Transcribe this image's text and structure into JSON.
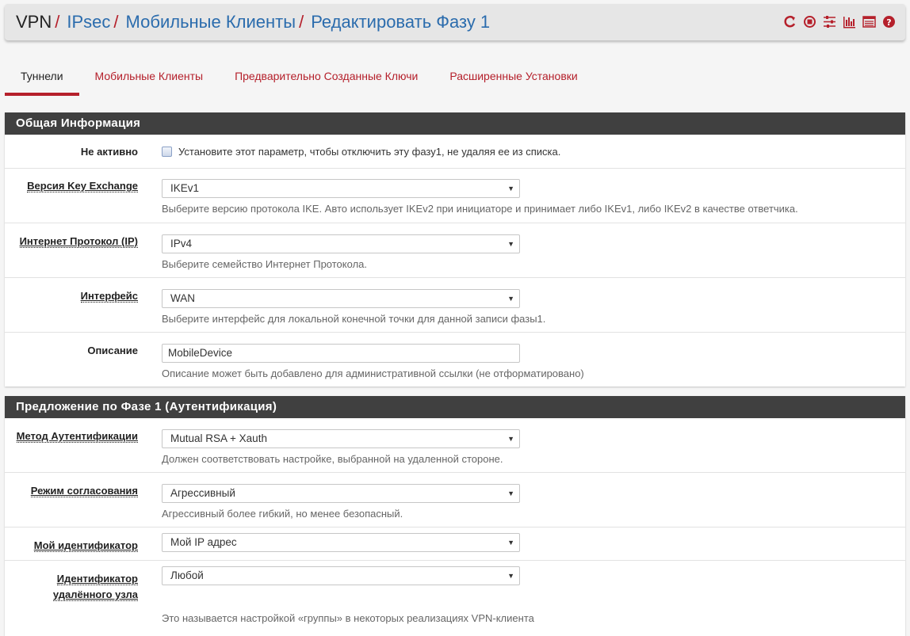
{
  "breadcrumb": [
    "VPN",
    "IPsec",
    "Мобильные Клиенты",
    "Редактировать Фазу 1"
  ],
  "header_icons": [
    "refresh-icon",
    "stop-icon",
    "sliders-icon",
    "chart-icon",
    "list-icon",
    "help-icon"
  ],
  "tabs": [
    {
      "label": "Туннели",
      "active": true
    },
    {
      "label": "Мобильные Клиенты"
    },
    {
      "label": "Предварительно Созданные Ключи"
    },
    {
      "label": "Расширенные Установки"
    }
  ],
  "general": {
    "title": "Общая Информация",
    "disabled": {
      "label": "Не активно",
      "checkbox_text": "Установите этот параметр, чтобы отключить эту фазу1, не удаляя ее из списка."
    },
    "key_exchange": {
      "label": "Версия Key Exchange",
      "value": "IKEv1",
      "help": "Выберите версию протокола IKE. Авто использует IKEv2 при инициаторе и принимает либо IKEv1, либо IKEv2 в качестве ответчика."
    },
    "protocol": {
      "label": "Интернет Протокол (IP)",
      "value": "IPv4",
      "help": "Выберите семейство Интернет Протокола."
    },
    "interface": {
      "label": "Интерфейс",
      "value": "WAN",
      "help": "Выберите интерфейс для локальной конечной точки для данной записи фазы1."
    },
    "description": {
      "label": "Описание",
      "value": "MobileDevice",
      "help": "Описание может быть добавлено для административной ссылки (не отформатировано)"
    }
  },
  "auth": {
    "title": "Предложение по Фазе 1 (Аутентификация)",
    "method": {
      "label": "Метод Аутентификации",
      "value": "Mutual RSA + Xauth",
      "help": "Должен соответствовать настройке, выбранной на удаленной стороне."
    },
    "mode": {
      "label": "Режим согласования",
      "value": "Агрессивный",
      "help": "Агрессивный более гибкий, но менее безопасный."
    },
    "my_id": {
      "label": "Мой идентификатор",
      "value": "Мой IP адрес"
    },
    "peer_id": {
      "label_line1": "Идентификатор",
      "label_line2": "удалённого узла",
      "value": "Любой",
      "help": "Это называется настройкой «группы» в некоторых реализациях VPN-клиента"
    }
  }
}
